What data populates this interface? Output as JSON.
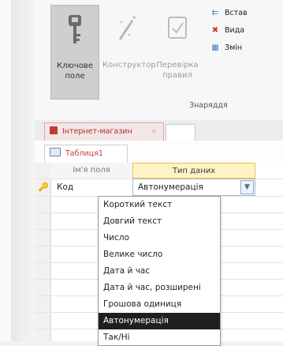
{
  "ribbon": {
    "key_field_label": "Ключове поле",
    "constructor_label": "Конструктор",
    "check_rules_label": "Перевірка правил",
    "insert_rows_label": "Встав",
    "delete_rows_label": "Вида",
    "modify_label": "Змін",
    "tools_group_label": "Знаряддя"
  },
  "document_tab": {
    "label": "Інтернет-магазин",
    "close_symbol": "×"
  },
  "object_tab": {
    "label": "Таблиця1"
  },
  "grid": {
    "headers": {
      "field_name": "Ім'я поля",
      "data_type": "Тип даних"
    },
    "rows": [
      {
        "field_name": "Код",
        "data_type": "Автонумерація"
      }
    ],
    "key_marker": "🔑"
  },
  "dropdown": {
    "selected": "Автонумерація",
    "options": [
      "Короткий текст",
      "Довгий текст",
      "Число",
      "Велике число",
      "Дата й час",
      "Дата й час, розширені",
      "Грошова одиниця",
      "Автонумерація",
      "Так/Ні"
    ]
  },
  "colors": {
    "active_header_bg": "#fff3c6",
    "selected_option_bg": "#1f1f1f",
    "doc_tab_text": "#a83232"
  }
}
